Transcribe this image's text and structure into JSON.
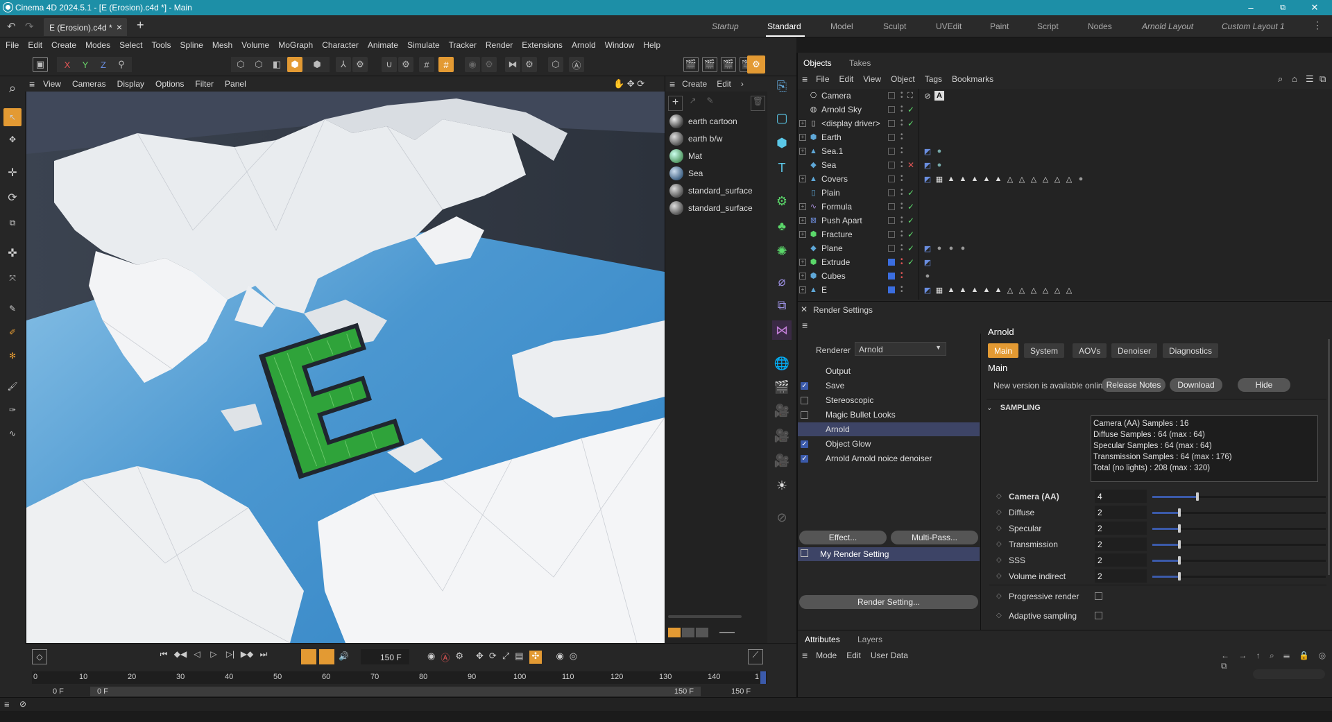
{
  "window": {
    "title": "Cinema 4D 2024.5.1 - [E (Erosion).c4d *] - Main",
    "minimize": "–",
    "maximize": "⧉",
    "close": "✕"
  },
  "doc_tab": {
    "label": "E (Erosion).c4d *",
    "close": "×",
    "new": "+"
  },
  "layouts": [
    {
      "label": "Startup"
    },
    {
      "label": "Standard"
    },
    {
      "label": "Model"
    },
    {
      "label": "Sculpt"
    },
    {
      "label": "UVEdit"
    },
    {
      "label": "Paint"
    },
    {
      "label": "Script"
    },
    {
      "label": "Nodes"
    },
    {
      "label": "Arnold Layout"
    },
    {
      "label": "Custom Layout 1"
    }
  ],
  "menu": [
    "File",
    "Edit",
    "Create",
    "Modes",
    "Select",
    "Tools",
    "Spline",
    "Mesh",
    "Volume",
    "MoGraph",
    "Character",
    "Animate",
    "Simulate",
    "Tracker",
    "Render",
    "Extensions",
    "Arnold",
    "Window",
    "Help"
  ],
  "axis": {
    "x": "X",
    "y": "Y",
    "z": "Z"
  },
  "viewport_menu": [
    "View",
    "Cameras",
    "Display",
    "Options",
    "Filter",
    "Panel"
  ],
  "material_menu": [
    "Create",
    "Edit"
  ],
  "materials": [
    "earth cartoon",
    "earth b/w",
    "Mat",
    "Sea",
    "standard_surface",
    "standard_surface"
  ],
  "objects_tabs": [
    "Objects",
    "Takes"
  ],
  "objects_menu": [
    "File",
    "Edit",
    "View",
    "Object",
    "Tags",
    "Bookmarks"
  ],
  "objects": [
    {
      "name": "Camera",
      "check": "",
      "color": "#cfcfcf"
    },
    {
      "name": "Arnold Sky",
      "check": "✓",
      "color": "#cfcfcf"
    },
    {
      "name": "<display driver>",
      "check": "✓",
      "color": "#cfcfcf"
    },
    {
      "name": "Earth",
      "check": "",
      "color": "#5fa8d8"
    },
    {
      "name": "Sea.1",
      "check": "",
      "color": "#5fa8d8"
    },
    {
      "name": "Sea",
      "check": "✕",
      "color": "#5fa8d8"
    },
    {
      "name": "Covers",
      "check": "",
      "color": "#5fa8d8"
    },
    {
      "name": "Plain",
      "check": "✓",
      "color": "#5fa8d8"
    },
    {
      "name": "Formula",
      "check": "✓",
      "color": "#a78fd8"
    },
    {
      "name": "Push Apart",
      "check": "✓",
      "color": "#6f8fe0"
    },
    {
      "name": "Fracture",
      "check": "✓",
      "color": "#5bd86a"
    },
    {
      "name": "Plane",
      "check": "✓",
      "color": "#5fa8d8"
    },
    {
      "name": "Extrude",
      "check": "✓",
      "color": "#5bd86a"
    },
    {
      "name": "Cubes",
      "check": "",
      "color": "#5fa8d8"
    },
    {
      "name": "E",
      "check": "",
      "color": "#5fa8d8"
    }
  ],
  "render_settings": {
    "title": "Render Settings",
    "renderer_label": "Renderer",
    "renderer_value": "Arnold",
    "items": [
      {
        "label": "Output",
        "checked": false,
        "box": false
      },
      {
        "label": "Save",
        "checked": true,
        "box": true
      },
      {
        "label": "Stereoscopic",
        "checked": false,
        "box": true
      },
      {
        "label": "Magic Bullet Looks",
        "checked": false,
        "box": true
      },
      {
        "label": "Arnold",
        "checked": false,
        "box": false
      },
      {
        "label": "Object Glow",
        "checked": true,
        "box": true
      },
      {
        "label": "Arnold Arnold noice denoiser",
        "checked": true,
        "box": true
      }
    ],
    "effect_btn": "Effect...",
    "multipass_btn": "Multi-Pass...",
    "setting_name": "My Render Setting",
    "render_setting_btn": "Render Setting...",
    "header": "Arnold",
    "tabs": [
      "Main",
      "System",
      "AOVs",
      "Denoiser",
      "Diagnostics"
    ],
    "section": "Main",
    "new_version": "New version is available online: ...",
    "release_notes": "Release Notes",
    "download": "Download",
    "hide": "Hide",
    "sampling": "SAMPLING",
    "info": [
      "Camera (AA) Samples : 16",
      "Diffuse Samples : 64 (max : 64)",
      "Specular Samples : 64 (max : 64)",
      "Transmission Samples : 64 (max : 176)",
      "Total (no lights) : 208 (max : 320)"
    ],
    "params": [
      {
        "label": "Camera (AA)",
        "value": "4",
        "frac": 0.26,
        "bold": true
      },
      {
        "label": "Diffuse",
        "value": "2",
        "frac": 0.155,
        "bold": false
      },
      {
        "label": "Specular",
        "value": "2",
        "frac": 0.155,
        "bold": false
      },
      {
        "label": "Transmission",
        "value": "2",
        "frac": 0.155,
        "bold": false
      },
      {
        "label": "SSS",
        "value": "2",
        "frac": 0.155,
        "bold": false
      },
      {
        "label": "Volume indirect",
        "value": "2",
        "frac": 0.155,
        "bold": false
      }
    ],
    "progressive": "Progressive render",
    "adaptive": "Adaptive sampling"
  },
  "attributes": {
    "tabs": [
      "Attributes",
      "Layers"
    ],
    "menu": [
      "Mode",
      "Edit",
      "User Data"
    ]
  },
  "timeline": {
    "frame": "150 F",
    "ticks": [
      "0",
      "10",
      "20",
      "30",
      "40",
      "50",
      "60",
      "70",
      "80",
      "90",
      "100",
      "110",
      "120",
      "130",
      "140",
      "1"
    ],
    "start": "0 F",
    "range_start": "0 F",
    "range_end": "150 F",
    "end": "150 F"
  }
}
